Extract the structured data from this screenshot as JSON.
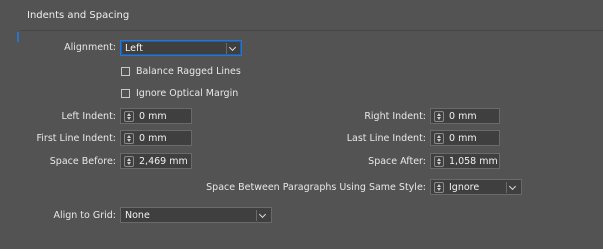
{
  "panel": {
    "title": "Indents and Spacing"
  },
  "alignment": {
    "label": "Alignment:",
    "value": "Left"
  },
  "checkboxes": [
    {
      "label": "Balance Ragged Lines"
    },
    {
      "label": "Ignore Optical Margin"
    }
  ],
  "left_indent": {
    "label": "Left Indent:",
    "value": "0 mm"
  },
  "right_indent": {
    "label": "Right Indent:",
    "value": "0 mm"
  },
  "first_line_indent": {
    "label": "First Line Indent:",
    "value": "0 mm"
  },
  "last_line_indent": {
    "label": "Last Line Indent:",
    "value": "0 mm"
  },
  "space_before": {
    "label": "Space Before:",
    "value": "2,469 mm"
  },
  "space_after": {
    "label": "Space After:",
    "value": "1,058 mm"
  },
  "same_style": {
    "label": "Space Between Paragraphs Using Same Style:",
    "value": "Ignore"
  },
  "align_to_grid": {
    "label": "Align to Grid:",
    "value": "None"
  },
  "colors": {
    "background": "#535353",
    "field": "#3f3f3f",
    "accent": "#2c74c9"
  }
}
